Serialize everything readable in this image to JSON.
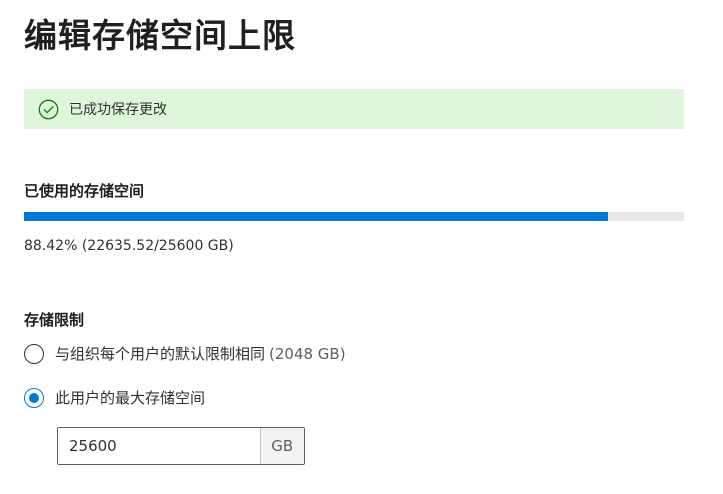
{
  "page": {
    "title": "编辑存储空间上限"
  },
  "notification": {
    "icon": "checkmark-circle-icon",
    "message": "已成功保存更改",
    "color": "#dff6dd"
  },
  "usage": {
    "heading": "已使用的存储空间",
    "percent": 88.42,
    "text": "88.42% (22635.52/25600 GB)",
    "fill_color": "#0078d4"
  },
  "limit": {
    "heading": "存储限制",
    "options": [
      {
        "label": "与组织每个用户的默认限制相同",
        "sub": "(2048 GB)",
        "checked": false
      },
      {
        "label": "此用户的最大存储空间",
        "sub": "",
        "checked": true
      }
    ],
    "quota_value": "25600",
    "quota_unit": "GB"
  }
}
